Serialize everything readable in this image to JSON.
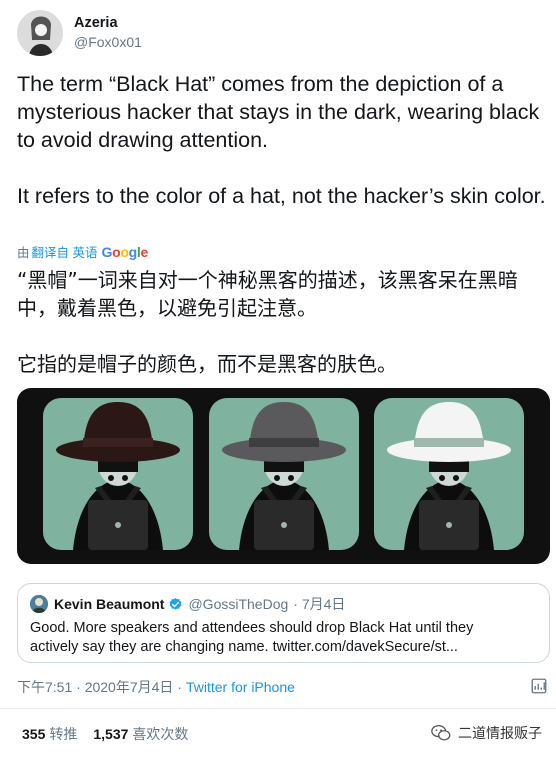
{
  "author": {
    "display_name": "Azeria",
    "handle": "@Fox0x01"
  },
  "tweet": {
    "text": "The term “Black Hat” comes from the depiction of a mysterious hacker that stays in the dark, wearing black to avoid drawing attention.\n\nIt refers to the color of a hat, not the hacker’s skin color.",
    "translated_by_prefix": "由",
    "translated_by_language": "翻译自 英语",
    "translation_provider": "Google",
    "translation": "“黑帽”一词来自对一个神秘黑客的描述，该黑客呆在黑暗中，戴着黑色，以避免引起注意。\n\n它指的是帽子的颜色，而不是黑客的肤色。"
  },
  "media": {
    "background_color": "#101010",
    "panel_color": "#7fb3a0",
    "hat_colors": [
      "#2b1816",
      "#5a5a5c",
      "#f4f4f4"
    ]
  },
  "quoted_tweet": {
    "display_name": "Kevin Beaumont",
    "handle": "@GossiTheDog",
    "date": "· 7月4日",
    "text_line1": "Good. More speakers and attendees should drop Black Hat until they",
    "text_line2": "actively say they are changing name. twitter.com/davekSecure/st..."
  },
  "meta": {
    "time_date": "下午7:51 · 2020年7月4日 ·",
    "source": "Twitter for iPhone"
  },
  "stats": {
    "retweets_count": "355",
    "retweets_label": "转推",
    "likes_count": "1,537",
    "likes_label": "喜欢次数"
  },
  "watermark": {
    "text": "二道情报贩子"
  },
  "colors": {
    "link": "#1b95e0",
    "secondary_text": "#657786",
    "border": "#ccd6dd"
  }
}
